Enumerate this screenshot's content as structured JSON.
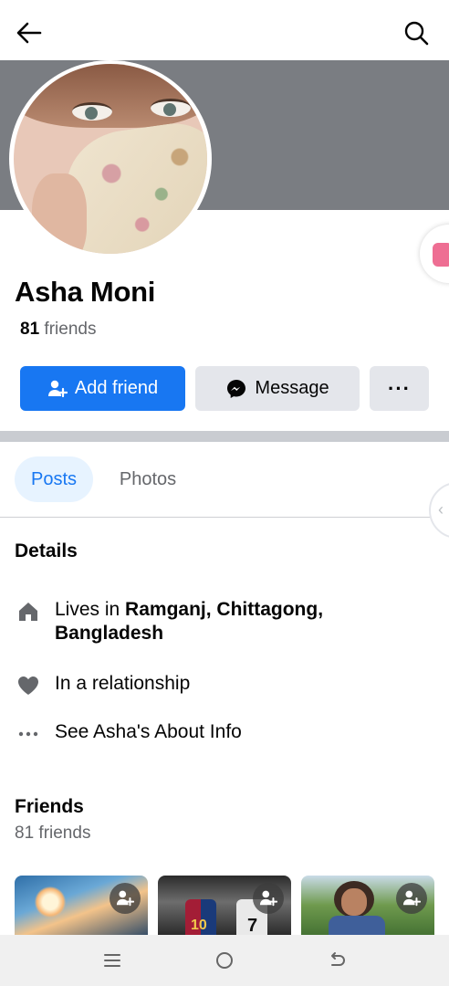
{
  "profile": {
    "name": "Asha Moni",
    "friends_count": "81",
    "friends_word": "friends"
  },
  "actions": {
    "add_friend": "Add friend",
    "message": "Message",
    "more": "···"
  },
  "tabs": [
    {
      "label": "Posts",
      "active": true
    },
    {
      "label": "Photos",
      "active": false
    }
  ],
  "details": {
    "heading": "Details",
    "lives_prefix": "Lives in ",
    "lives_place_line1": "Ramganj, Chittagong,",
    "lives_place_line2": "Bangladesh",
    "relationship": "In a relationship",
    "about": "See Asha's About Info"
  },
  "friends_section": {
    "heading": "Friends",
    "subtitle": "81 friends",
    "thumb2_numbers": [
      "10",
      "7"
    ]
  },
  "colors": {
    "accent": "#1877f2",
    "cover": "#7a7d82",
    "secondary_button": "#e4e6eb"
  },
  "icons": [
    "back-arrow-icon",
    "search-icon",
    "add-person-icon",
    "messenger-icon",
    "home-icon",
    "heart-icon",
    "more-dots-icon",
    "menu-icon",
    "home-circle-icon",
    "back-return-icon"
  ]
}
